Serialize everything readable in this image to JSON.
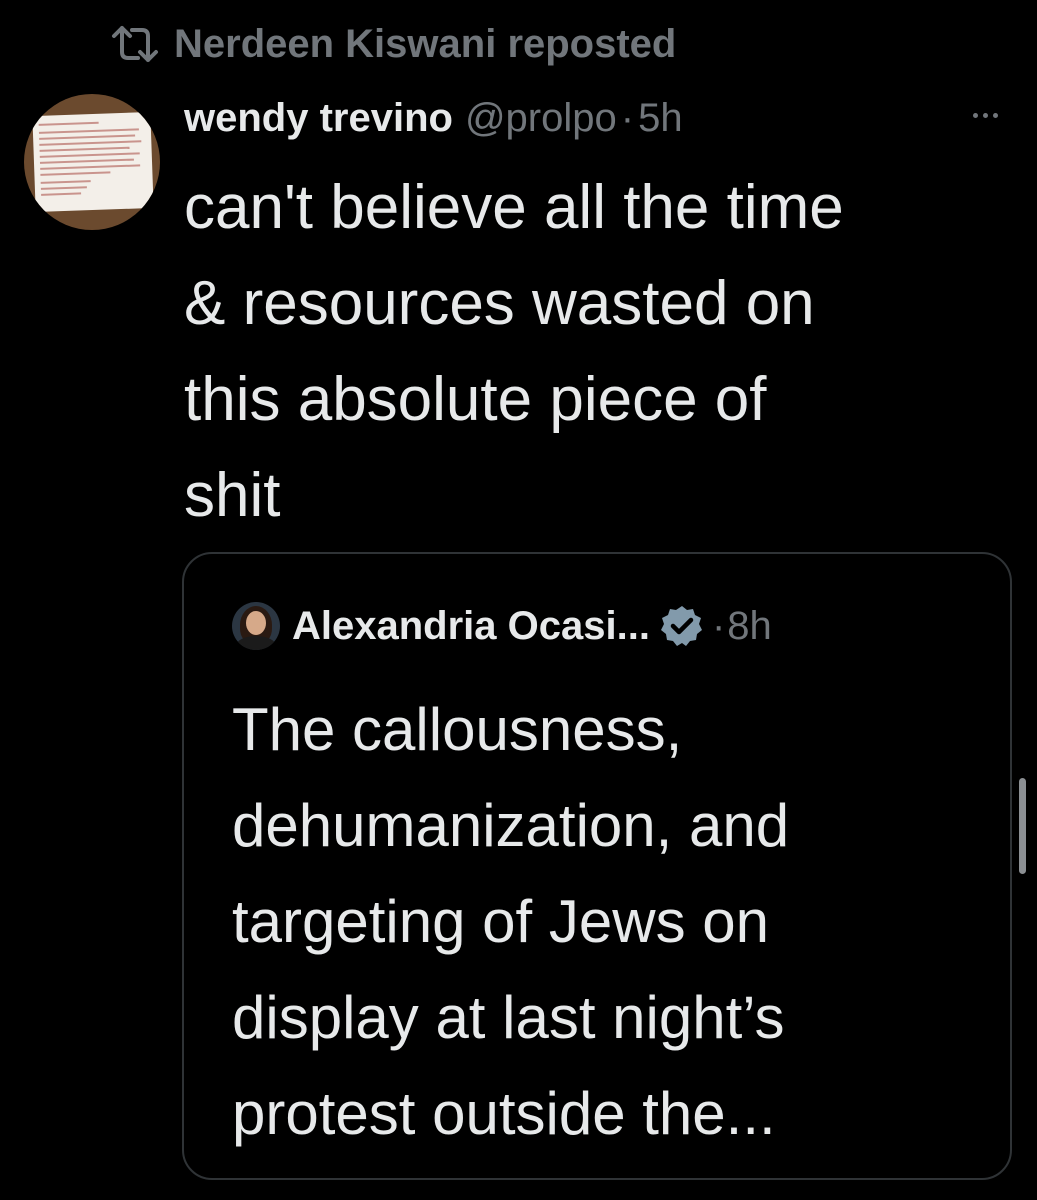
{
  "repost": {
    "icon": "repost-icon",
    "text": "Nerdeen Kiswani reposted"
  },
  "tweet": {
    "author": {
      "display_name": "wendy trevino",
      "handle": "@prolpo",
      "separator": "·",
      "time": "5h"
    },
    "more_icon": "more-icon",
    "text_lines": [
      "can't believe all the time",
      "& resources wasted on",
      "this absolute piece of",
      "shit"
    ]
  },
  "quote": {
    "author": {
      "display_name": "Alexandria Ocasi...",
      "verified_icon": "verified-badge-icon",
      "separator": "·",
      "time": "8h"
    },
    "text_lines": [
      "The callousness,",
      "dehumanization, and",
      "targeting of Jews on",
      "display at last night’s",
      "protest outside the..."
    ]
  },
  "colors": {
    "background": "#000000",
    "text_primary": "#e7e9ea",
    "text_secondary": "#71767b",
    "border": "#2f3336",
    "verified_badge": "#829aab"
  }
}
